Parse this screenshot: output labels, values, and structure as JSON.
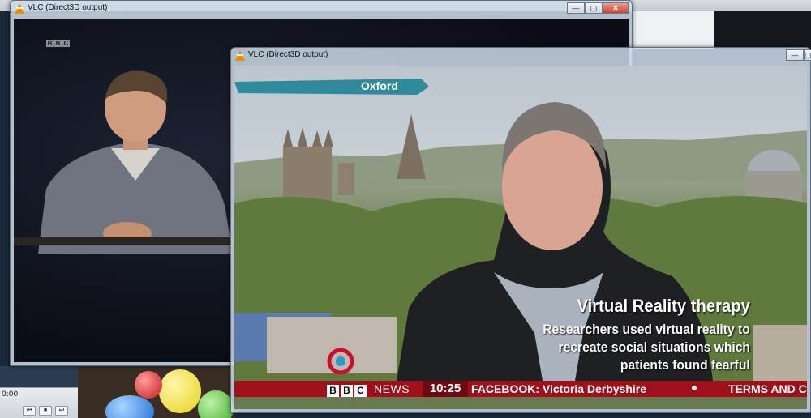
{
  "desktop": {
    "mini_player": {
      "time": "0:00",
      "buttons": [
        {
          "label": "⏮",
          "icon": "previous-icon"
        },
        {
          "label": "■",
          "icon": "stop-icon"
        },
        {
          "label": "⏭",
          "icon": "next-icon"
        }
      ]
    }
  },
  "window_back": {
    "title": "VLC (Direct3D output)",
    "controls": {
      "minimize": "—",
      "maximize": "▢",
      "close": "✕"
    },
    "video": {
      "channel_dog": [
        "B",
        "B",
        "C"
      ]
    }
  },
  "window_front": {
    "title": "VLC (Direct3D output)",
    "controls": {
      "minimize": "—",
      "maximize": "▢",
      "close": "✕"
    },
    "video": {
      "location": "Oxford",
      "caption_title": "Virtual Reality therapy",
      "caption_lines": [
        "Researchers used virtual reality to",
        "recreate social situations which",
        "patients found fearful"
      ],
      "ticker": {
        "brand_blocks": [
          "B",
          "B",
          "C"
        ],
        "brand_text": "NEWS",
        "time": "10:25",
        "crawl_text": "FACEBOOK: Victoria Derbyshire",
        "crawl_text_2": "TERMS AND C"
      }
    }
  },
  "colors": {
    "ticker_red": "#a0101a",
    "location_teal": "#2f8b9c",
    "vlc_orange": "#f08a00"
  }
}
